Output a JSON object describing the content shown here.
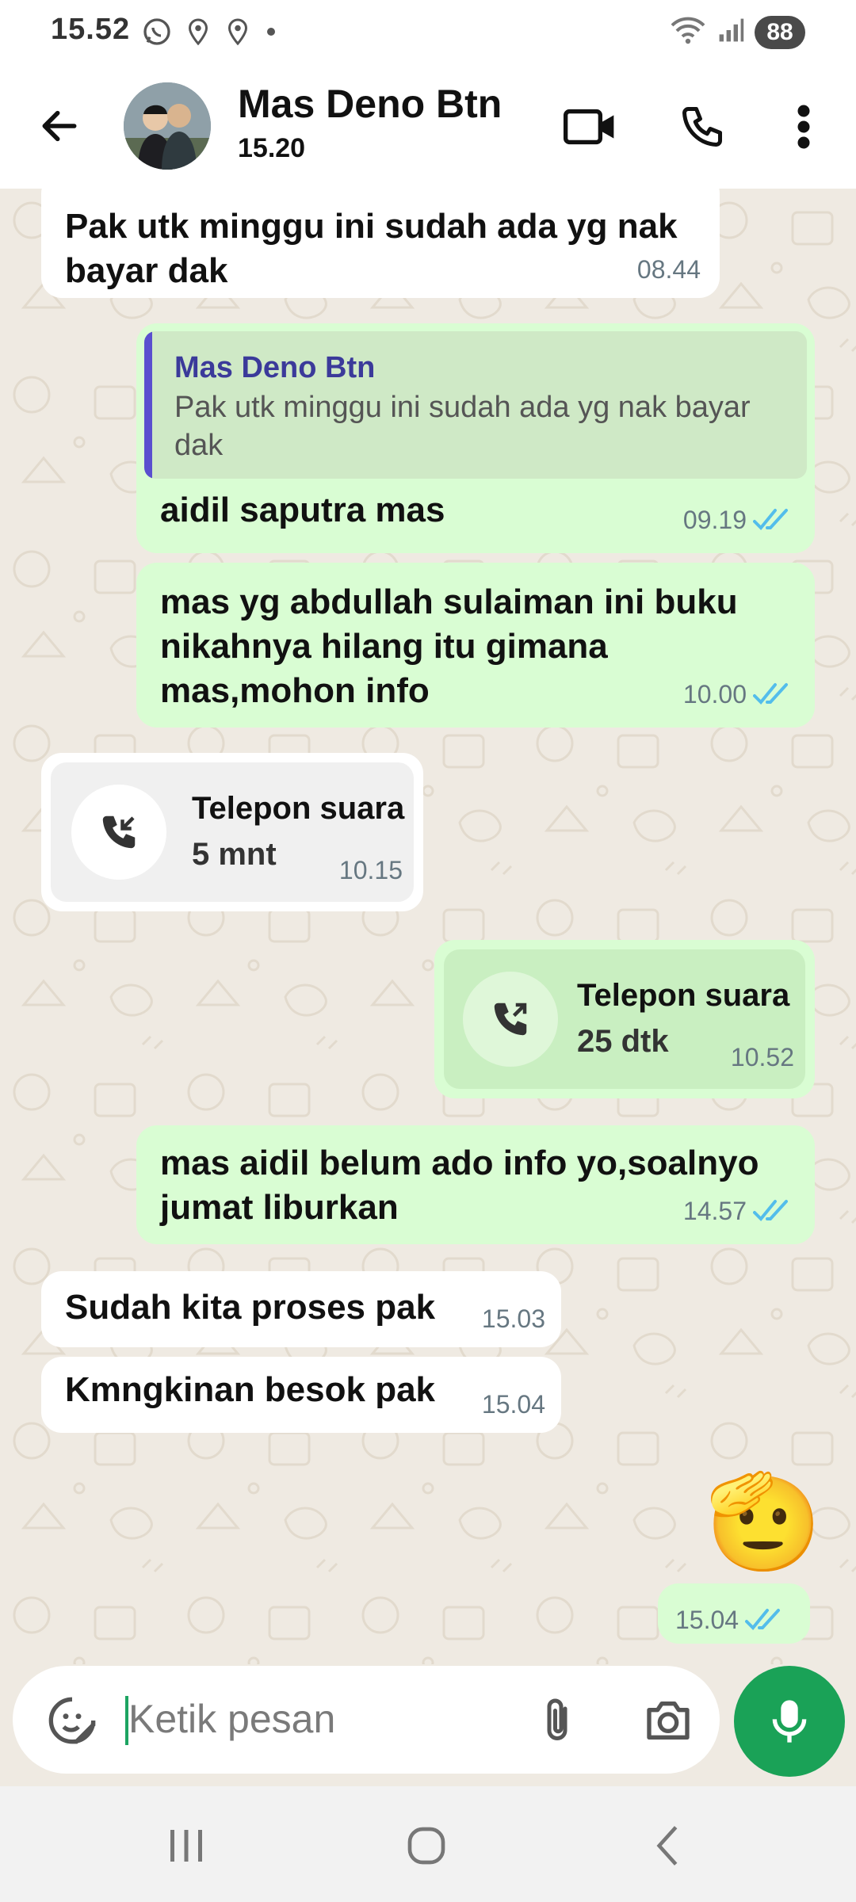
{
  "status_bar": {
    "time": "15.52",
    "battery": "88"
  },
  "header": {
    "contact_name": "Mas Deno Btn",
    "contact_status": "15.20"
  },
  "messages": [
    {
      "dir": "in",
      "text": "Pak utk minggu ini sudah ada yg nak bayar dak",
      "time": "08.44"
    },
    {
      "dir": "out",
      "quote_name": "Mas Deno Btn",
      "quote_text": "Pak utk minggu ini sudah ada yg nak bayar dak",
      "text": "aidil saputra mas",
      "time": "09.19"
    },
    {
      "dir": "out",
      "text": "mas yg abdullah sulaiman ini buku nikahnya hilang itu gimana mas,mohon info",
      "time": "10.00"
    },
    {
      "dir": "in",
      "call_title": "Telepon suara",
      "call_duration": "5 mnt",
      "time": "10.15"
    },
    {
      "dir": "out",
      "call_title": "Telepon suara",
      "call_duration": "25 dtk",
      "time": "10.52"
    },
    {
      "dir": "out",
      "text": "mas aidil belum ado info yo,soalnyo jumat liburkan",
      "time": "14.57"
    },
    {
      "dir": "in",
      "text": "Sudah kita proses pak",
      "time": "15.03"
    },
    {
      "dir": "in",
      "text": "Kmngkinan besok pak",
      "time": "15.04"
    },
    {
      "dir": "out",
      "emoji": "🫡",
      "time": "15.04"
    }
  ],
  "input": {
    "placeholder": "Ketik pesan"
  },
  "colors": {
    "outgoing_bubble": "#d9fdd3",
    "incoming_bubble": "#ffffff",
    "chat_bg": "#efeae2",
    "accent_green": "#1aa257",
    "read_ticks": "#53bdeb"
  }
}
